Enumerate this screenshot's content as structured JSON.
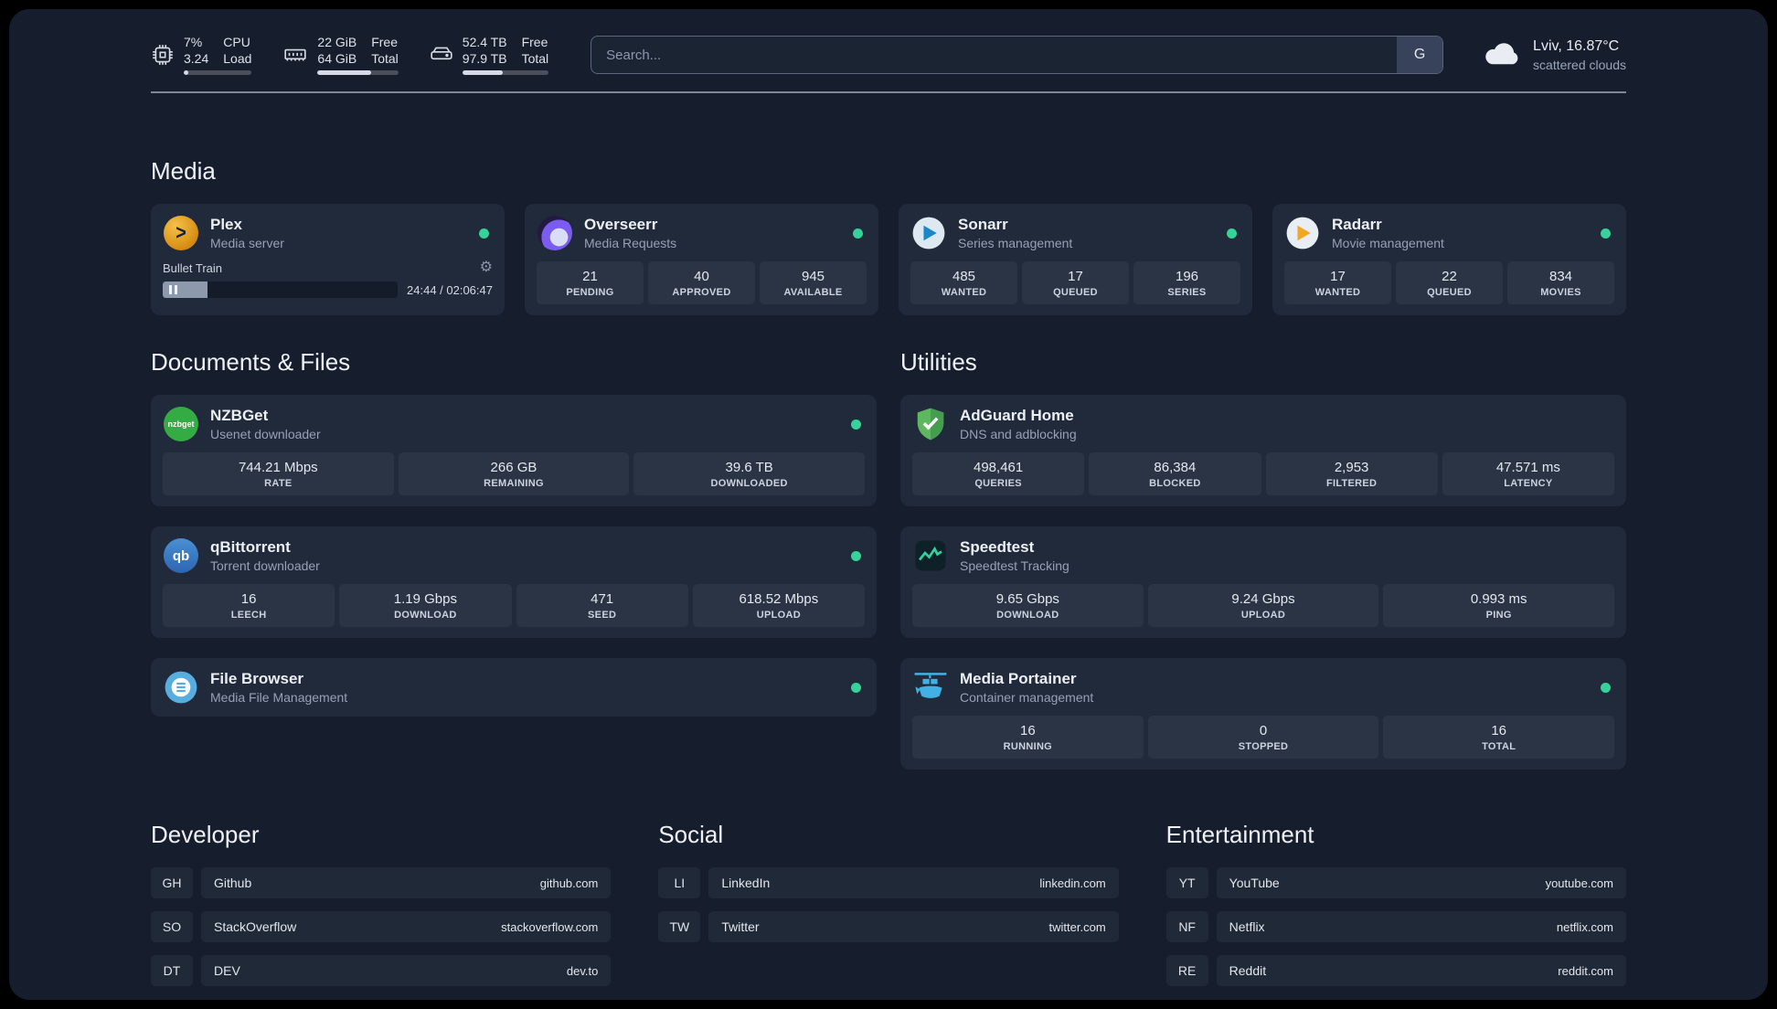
{
  "topbar": {
    "cpu": {
      "value_top": "7%",
      "value_bottom": "3.24",
      "label_top": "CPU",
      "label_bottom": "Load",
      "percent": 7
    },
    "ram": {
      "value_top": "22 GiB",
      "value_bottom": "64 GiB",
      "label_top": "Free",
      "label_bottom": "Total",
      "percent": 66
    },
    "disk": {
      "value_top": "52.4 TB",
      "value_bottom": "97.9 TB",
      "label_top": "Free",
      "label_bottom": "Total",
      "percent": 47
    },
    "search": {
      "placeholder": "Search...",
      "provider": "G"
    },
    "weather": {
      "location": "Lviv, 16.87°C",
      "condition": "scattered clouds"
    }
  },
  "sections": {
    "media": "Media",
    "documents": "Documents & Files",
    "utilities": "Utilities",
    "developer": "Developer",
    "social": "Social",
    "entertainment": "Entertainment"
  },
  "services": {
    "plex": {
      "name": "Plex",
      "subtitle": "Media server",
      "status": "online",
      "player": {
        "track": "Bullet Train",
        "time": "24:44 / 02:06:47",
        "progress": 19
      }
    },
    "overseerr": {
      "name": "Overseerr",
      "subtitle": "Media Requests",
      "status": "online",
      "stats": [
        {
          "value": "21",
          "label": "PENDING"
        },
        {
          "value": "40",
          "label": "APPROVED"
        },
        {
          "value": "945",
          "label": "AVAILABLE"
        }
      ]
    },
    "sonarr": {
      "name": "Sonarr",
      "subtitle": "Series management",
      "status": "online",
      "stats": [
        {
          "value": "485",
          "label": "WANTED"
        },
        {
          "value": "17",
          "label": "QUEUED"
        },
        {
          "value": "196",
          "label": "SERIES"
        }
      ]
    },
    "radarr": {
      "name": "Radarr",
      "subtitle": "Movie management",
      "status": "online",
      "stats": [
        {
          "value": "17",
          "label": "WANTED"
        },
        {
          "value": "22",
          "label": "QUEUED"
        },
        {
          "value": "834",
          "label": "MOVIES"
        }
      ]
    },
    "nzbget": {
      "name": "NZBGet",
      "subtitle": "Usenet downloader",
      "status": "online",
      "stats": [
        {
          "value": "744.21 Mbps",
          "label": "RATE"
        },
        {
          "value": "266 GB",
          "label": "REMAINING"
        },
        {
          "value": "39.6 TB",
          "label": "DOWNLOADED"
        }
      ]
    },
    "qbittorrent": {
      "name": "qBittorrent",
      "subtitle": "Torrent downloader",
      "status": "online",
      "stats": [
        {
          "value": "16",
          "label": "LEECH"
        },
        {
          "value": "1.19 Gbps",
          "label": "DOWNLOAD"
        },
        {
          "value": "471",
          "label": "SEED"
        },
        {
          "value": "618.52 Mbps",
          "label": "UPLOAD"
        }
      ]
    },
    "filebrowser": {
      "name": "File Browser",
      "subtitle": "Media File Management",
      "status": "online"
    },
    "adguard": {
      "name": "AdGuard Home",
      "subtitle": "DNS and adblocking",
      "stats": [
        {
          "value": "498,461",
          "label": "QUERIES"
        },
        {
          "value": "86,384",
          "label": "BLOCKED"
        },
        {
          "value": "2,953",
          "label": "FILTERED"
        },
        {
          "value": "47.571 ms",
          "label": "LATENCY"
        }
      ]
    },
    "speedtest": {
      "name": "Speedtest",
      "subtitle": "Speedtest Tracking",
      "stats": [
        {
          "value": "9.65 Gbps",
          "label": "DOWNLOAD"
        },
        {
          "value": "9.24 Gbps",
          "label": "UPLOAD"
        },
        {
          "value": "0.993 ms",
          "label": "PING"
        }
      ]
    },
    "portainer": {
      "name": "Media Portainer",
      "subtitle": "Container management",
      "status": "online",
      "stats": [
        {
          "value": "16",
          "label": "RUNNING"
        },
        {
          "value": "0",
          "label": "STOPPED"
        },
        {
          "value": "16",
          "label": "TOTAL"
        }
      ]
    }
  },
  "bookmarks": {
    "developer": [
      {
        "abbr": "GH",
        "name": "Github",
        "domain": "github.com"
      },
      {
        "abbr": "SO",
        "name": "StackOverflow",
        "domain": "stackoverflow.com"
      },
      {
        "abbr": "DT",
        "name": "DEV",
        "domain": "dev.to"
      }
    ],
    "social": [
      {
        "abbr": "LI",
        "name": "LinkedIn",
        "domain": "linkedin.com"
      },
      {
        "abbr": "TW",
        "name": "Twitter",
        "domain": "twitter.com"
      }
    ],
    "entertainment": [
      {
        "abbr": "YT",
        "name": "YouTube",
        "domain": "youtube.com"
      },
      {
        "abbr": "NF",
        "name": "Netflix",
        "domain": "netflix.com"
      },
      {
        "abbr": "RE",
        "name": "Reddit",
        "domain": "reddit.com"
      }
    ]
  },
  "icons": {
    "cpu": "cpu-chip-icon",
    "ram": "memory-icon",
    "disk": "hard-drive-icon",
    "weather": "cloud-icon",
    "settings": "gear-icon",
    "pause": "pause-icon"
  },
  "colors": {
    "background": "#161e2d",
    "card": "#212a3a",
    "stat_tile": "#2a3445",
    "status_online": "#34d399",
    "plex_accent": "#e5a00d",
    "adguard_accent": "#5eb85f",
    "speedtest_accent": "#2dd4a0",
    "portainer_accent": "#41b0e4"
  }
}
